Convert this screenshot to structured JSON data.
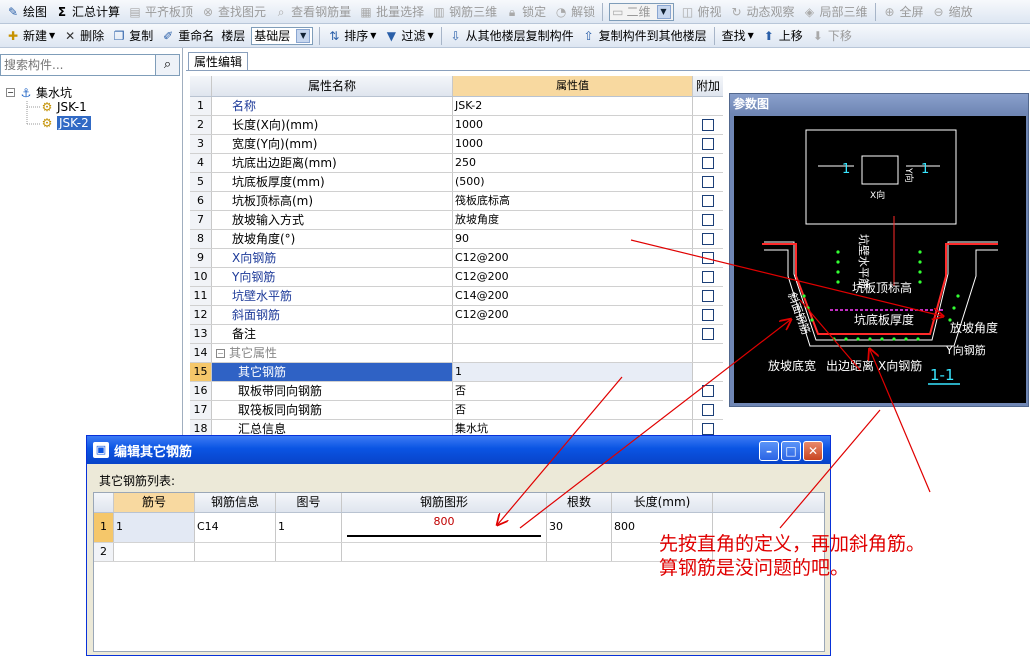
{
  "toolbar1": {
    "draw": "绘图",
    "sum_calc": "汇总计算",
    "flush_slab": "平齐板顶",
    "find_element": "查找图元",
    "view_rebar": "查看钢筋量",
    "batch_select": "批量选择",
    "rebar_3d": "钢筋三维",
    "lock": "锁定",
    "unlock": "解锁",
    "view_mode": "二维",
    "top_view": "俯视",
    "dynamic_view": "动态观察",
    "local_3d": "局部三维",
    "fullscreen": "全屏",
    "zoom": "缩放"
  },
  "toolbar2": {
    "new": "新建",
    "delete": "删除",
    "copy": "复制",
    "rename": "重命名",
    "floor_label": "楼层",
    "floor_value": "基础层",
    "sort": "排序",
    "filter": "过滤",
    "copy_from_floor": "从其他楼层复制构件",
    "copy_to_floor": "复制构件到其他楼层",
    "find": "查找",
    "move_up": "上移",
    "move_down": "下移"
  },
  "left": {
    "search_placeholder": "搜索构件...",
    "root": "集水坑",
    "items": [
      "JSK-1",
      "JSK-2"
    ]
  },
  "tab": "属性编辑",
  "grid": {
    "headers": [
      "属性名称",
      "属性值",
      "附加"
    ],
    "rows": [
      {
        "no": "1",
        "name": "名称",
        "value": "JSK-2"
      },
      {
        "no": "2",
        "name": "长度(X向)(mm)",
        "value": "1000"
      },
      {
        "no": "3",
        "name": "宽度(Y向)(mm)",
        "value": "1000"
      },
      {
        "no": "4",
        "name": "坑底出边距离(mm)",
        "value": "250"
      },
      {
        "no": "5",
        "name": "坑底板厚度(mm)",
        "value": "(500)"
      },
      {
        "no": "6",
        "name": "坑板顶标高(m)",
        "value": "筏板底标高"
      },
      {
        "no": "7",
        "name": "放坡输入方式",
        "value": "放坡角度"
      },
      {
        "no": "8",
        "name": "放坡角度(°)",
        "value": "90"
      },
      {
        "no": "9",
        "name": "X向钢筋",
        "value": "C12@200"
      },
      {
        "no": "10",
        "name": "Y向钢筋",
        "value": "C12@200"
      },
      {
        "no": "11",
        "name": "坑壁水平筋",
        "value": "C14@200"
      },
      {
        "no": "12",
        "name": "斜面钢筋",
        "value": "C12@200"
      },
      {
        "no": "13",
        "name": "备注",
        "value": ""
      },
      {
        "no": "14",
        "name": "其它属性",
        "value": ""
      },
      {
        "no": "15",
        "name": "其它钢筋",
        "value": "1"
      },
      {
        "no": "16",
        "name": "取板带同向钢筋",
        "value": "否"
      },
      {
        "no": "17",
        "name": "取筏板同向钢筋",
        "value": "否"
      },
      {
        "no": "18",
        "name": "汇总信息",
        "value": "集水坑"
      }
    ]
  },
  "ref": {
    "title": "参数图",
    "labels": {
      "sec_left": "1",
      "sec_right": "1",
      "x_dir": "X向",
      "y_dir": "Y向",
      "wall_horiz": "坑壁水平筋",
      "slope_rebar": "斜面钢筋",
      "top_elev": "坑板顶标高",
      "bottom_thick": "坑底板厚度",
      "slope_angle": "放坡角度",
      "y_rebar": "Y向钢筋",
      "slope_width": "放坡底宽",
      "edge_dist": "出边距离",
      "x_rebar": "X向钢筋",
      "section": "1-1"
    },
    "colors": {
      "wall": "#ff2a2a",
      "dots": "#33ff33",
      "label": "#ffffff",
      "accent": "#39e6ff"
    }
  },
  "dialog": {
    "title": "编辑其它钢筋",
    "list_label": "其它钢筋列表:",
    "headers": [
      "筋号",
      "钢筋信息",
      "图号",
      "钢筋图形",
      "根数",
      "长度(mm)"
    ],
    "rows": [
      {
        "no": "1",
        "bar": "1",
        "info": "C14",
        "fig": "1",
        "shape": "800",
        "count": "30",
        "length": "800"
      },
      {
        "no": "2",
        "bar": "",
        "info": "",
        "fig": "",
        "shape": "",
        "count": "",
        "length": ""
      }
    ]
  },
  "note": {
    "line1": "先按直角的定义，再加斜角筋。",
    "line2": "算钢筋是没问题的吧。",
    "color": "#e00000"
  }
}
